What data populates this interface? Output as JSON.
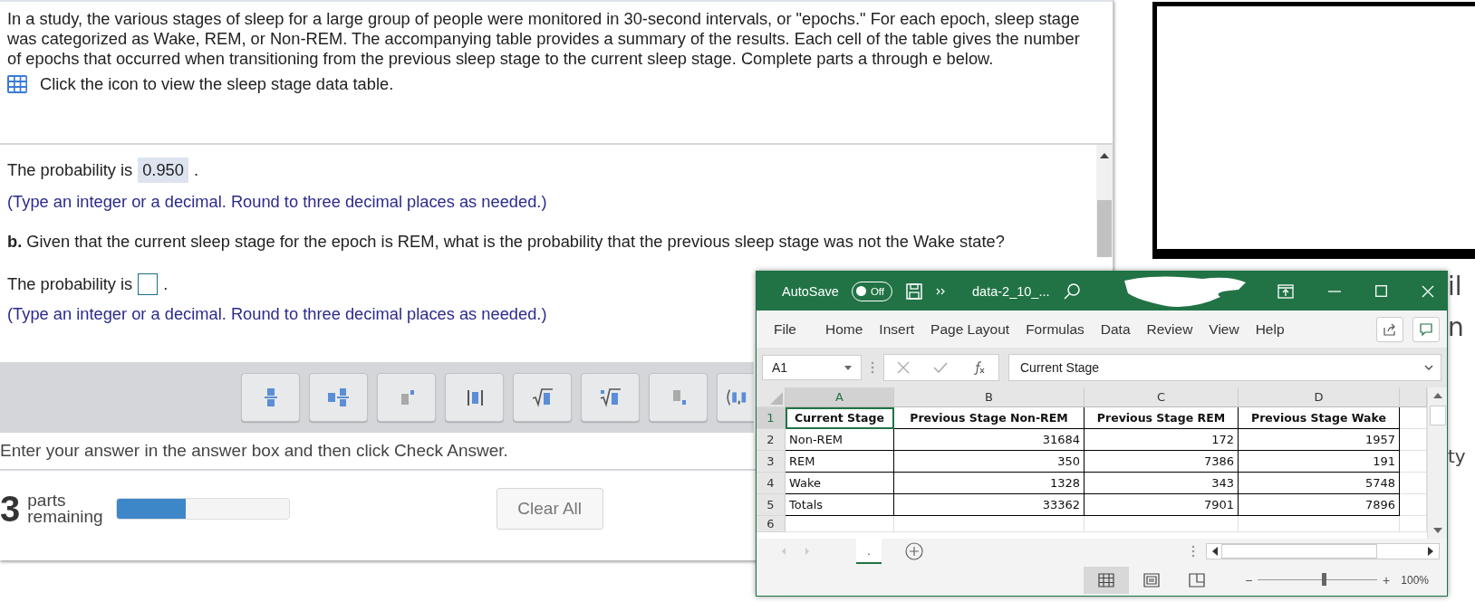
{
  "question": {
    "intro": "In a study, the various stages of sleep for a large group of people were monitored in 30-second intervals, or \"epochs.\" For each epoch, sleep stage was categorized as Wake, REM, or Non-REM. The accompanying table provides a summary of the results. Each cell of the table gives the number of epochs that occurred when transitioning from the previous sleep stage to the current sleep stage. Complete parts a through e below.",
    "data_table_link": "Click the icon to view the sleep stage data table."
  },
  "part_a": {
    "answer_prefix": "The probability is",
    "answer_value": "0.950",
    "answer_suffix": ".",
    "hint": "(Type an integer or a decimal. Round to three decimal places as needed.)"
  },
  "part_b": {
    "question": "**b.** Given that the current sleep stage for the epoch is REM, what is the probability that the previous sleep stage was not the Wake state?",
    "answer_prefix": "The probability is",
    "answer_suffix": ".",
    "hint": "(Type an integer or a decimal. Round to three decimal places as needed.)"
  },
  "math_toolbar": [
    {
      "kind": "fraction"
    },
    {
      "kind": "mixed-number"
    },
    {
      "kind": "exponent"
    },
    {
      "kind": "absolute-value"
    },
    {
      "kind": "square-root"
    },
    {
      "kind": "nth-root"
    },
    {
      "kind": "subscript"
    },
    {
      "kind": "ordered-pair"
    }
  ],
  "instruction": "Enter your answer in the answer box and then click Check Answer.",
  "progress": {
    "count": "3",
    "label_1": "parts",
    "label_2": "remaining",
    "level": 0.4
  },
  "clear_button": "Clear All",
  "background_fragments": [
    "il",
    "n",
    "ty"
  ],
  "excel": {
    "autosave_label": "AutoSave",
    "autosave_toggle": {
      "label": "Off",
      "on": false
    },
    "filename": "data-2_10_...",
    "ribbon_tabs": [
      "File",
      "Home",
      "Insert",
      "Page Layout",
      "Formulas",
      "Data",
      "Review",
      "View",
      "Help"
    ],
    "name_box": "A1",
    "formula": "Current Stage",
    "columns": [
      "A",
      "B",
      "C",
      "D"
    ],
    "rows": [
      {
        "number": "1",
        "cells": [
          "Current Stage",
          "Previous Stage Non-REM",
          "Previous Stage REM",
          "Previous Stage Wake"
        ]
      },
      {
        "number": "2",
        "cells": [
          "Non-REM",
          "31684",
          "172",
          "1957"
        ]
      },
      {
        "number": "3",
        "cells": [
          "REM",
          "350",
          "7386",
          "191"
        ]
      },
      {
        "number": "4",
        "cells": [
          "Wake",
          "1328",
          "343",
          "5748"
        ]
      },
      {
        "number": "5",
        "cells": [
          "Totals",
          "33362",
          "7901",
          "7896"
        ]
      },
      {
        "number": "6",
        "cells": []
      }
    ],
    "sheet_tab": ".",
    "zoom_label": "100%",
    "zoom_slider": {
      "minus": "−",
      "plus": "+",
      "level": 0.55
    }
  }
}
